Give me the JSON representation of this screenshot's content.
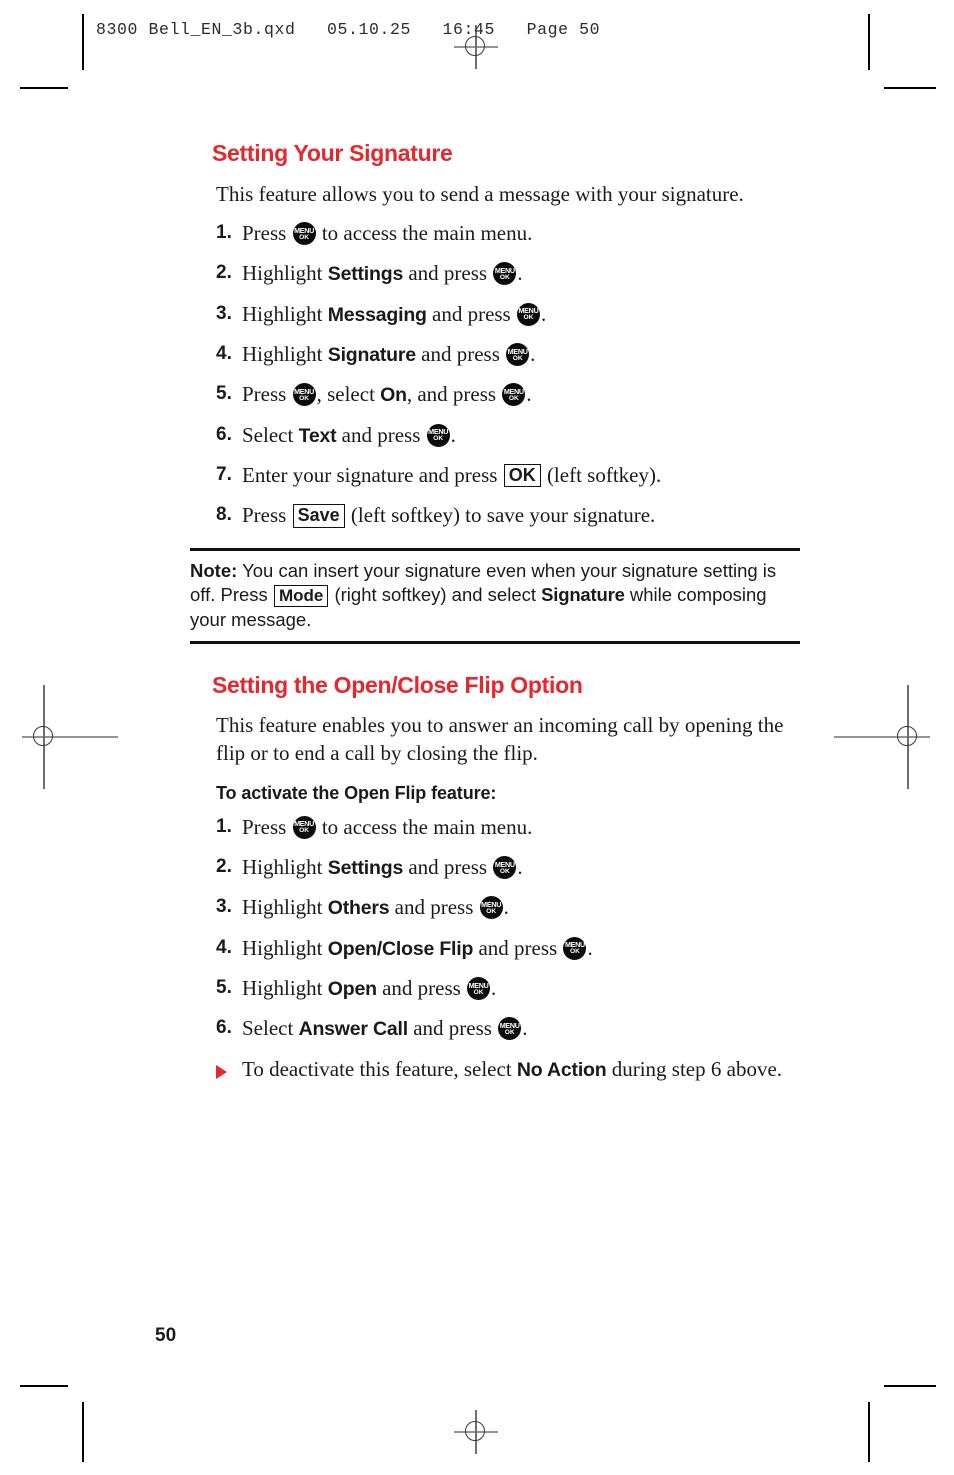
{
  "page": {
    "slug": "8300 Bell_EN_3b.qxd   05.10.25   16:45   Page 50",
    "folio": "50",
    "accent_color": "#E8262C",
    "text_color": "#1a1a1a"
  },
  "icons": {
    "menu_ok": {
      "line1": "MENU",
      "line2": "OK"
    },
    "bullet": "red-triangle-right"
  },
  "sections": [
    {
      "title": "Setting Your Signature",
      "intro": "This feature allows you to send a message with your signature.",
      "steps": [
        {
          "num": "1.",
          "parts": [
            {
              "t": "text",
              "v": "Press "
            },
            {
              "t": "key",
              "v": "MENU/OK"
            },
            {
              "t": "text",
              "v": " to access the main menu."
            }
          ]
        },
        {
          "num": "2.",
          "parts": [
            {
              "t": "text",
              "v": "Highlight "
            },
            {
              "t": "term",
              "v": "Settings"
            },
            {
              "t": "text",
              "v": " and press "
            },
            {
              "t": "key",
              "v": "MENU/OK"
            },
            {
              "t": "text",
              "v": "."
            }
          ]
        },
        {
          "num": "3.",
          "parts": [
            {
              "t": "text",
              "v": "Highlight "
            },
            {
              "t": "term",
              "v": "Messaging"
            },
            {
              "t": "text",
              "v": " and press "
            },
            {
              "t": "key",
              "v": "MENU/OK"
            },
            {
              "t": "text",
              "v": "."
            }
          ]
        },
        {
          "num": "4.",
          "parts": [
            {
              "t": "text",
              "v": "Highlight "
            },
            {
              "t": "term",
              "v": "Signature"
            },
            {
              "t": "text",
              "v": " and press "
            },
            {
              "t": "key",
              "v": "MENU/OK"
            },
            {
              "t": "text",
              "v": "."
            }
          ]
        },
        {
          "num": "5.",
          "parts": [
            {
              "t": "text",
              "v": "Press "
            },
            {
              "t": "key",
              "v": "MENU/OK"
            },
            {
              "t": "text",
              "v": ", select "
            },
            {
              "t": "term",
              "v": "On"
            },
            {
              "t": "text",
              "v": ", and press "
            },
            {
              "t": "key",
              "v": "MENU/OK"
            },
            {
              "t": "text",
              "v": "."
            }
          ]
        },
        {
          "num": "6.",
          "parts": [
            {
              "t": "text",
              "v": "Select "
            },
            {
              "t": "term",
              "v": "Text"
            },
            {
              "t": "text",
              "v": " and press "
            },
            {
              "t": "key",
              "v": "MENU/OK"
            },
            {
              "t": "text",
              "v": "."
            }
          ]
        },
        {
          "num": "7.",
          "parts": [
            {
              "t": "text",
              "v": "Enter your signature and press "
            },
            {
              "t": "softkey",
              "v": "OK"
            },
            {
              "t": "text",
              "v": " (left softkey)."
            }
          ]
        },
        {
          "num": "8.",
          "parts": [
            {
              "t": "text",
              "v": "Press "
            },
            {
              "t": "softkey",
              "v": "Save"
            },
            {
              "t": "text",
              "v": " (left softkey) to save your signature."
            }
          ]
        }
      ],
      "note": {
        "label": "Note:",
        "parts": [
          {
            "t": "bold",
            "v": "Note:"
          },
          {
            "t": "text",
            "v": " You can insert your signature even when your signature setting is off. Press "
          },
          {
            "t": "softkey",
            "v": "Mode"
          },
          {
            "t": "text",
            "v": " (right softkey) and select "
          },
          {
            "t": "term",
            "v": "Signature"
          },
          {
            "t": "text",
            "v": " while composing your message."
          }
        ]
      }
    },
    {
      "title": "Setting the Open/Close Flip Option",
      "intro": "This feature enables you to answer an incoming call by opening the flip or to end a call by closing the flip.",
      "subhead": "To activate the Open Flip feature:",
      "steps": [
        {
          "num": "1.",
          "parts": [
            {
              "t": "text",
              "v": "Press "
            },
            {
              "t": "key",
              "v": "MENU/OK"
            },
            {
              "t": "text",
              "v": " to access the main menu."
            }
          ]
        },
        {
          "num": "2.",
          "parts": [
            {
              "t": "text",
              "v": "Highlight "
            },
            {
              "t": "term",
              "v": "Settings"
            },
            {
              "t": "text",
              "v": " and press "
            },
            {
              "t": "key",
              "v": "MENU/OK"
            },
            {
              "t": "text",
              "v": "."
            }
          ]
        },
        {
          "num": "3.",
          "parts": [
            {
              "t": "text",
              "v": "Highlight "
            },
            {
              "t": "term",
              "v": "Others"
            },
            {
              "t": "text",
              "v": " and press "
            },
            {
              "t": "key",
              "v": "MENU/OK"
            },
            {
              "t": "text",
              "v": "."
            }
          ]
        },
        {
          "num": "4.",
          "parts": [
            {
              "t": "text",
              "v": "Highlight "
            },
            {
              "t": "term",
              "v": "Open/Close Flip"
            },
            {
              "t": "text",
              "v": " and press "
            },
            {
              "t": "key",
              "v": "MENU/OK"
            },
            {
              "t": "text",
              "v": "."
            }
          ]
        },
        {
          "num": "5.",
          "parts": [
            {
              "t": "text",
              "v": "Highlight "
            },
            {
              "t": "term",
              "v": "Open"
            },
            {
              "t": "text",
              "v": " and press "
            },
            {
              "t": "key",
              "v": "MENU/OK"
            },
            {
              "t": "text",
              "v": "."
            }
          ]
        },
        {
          "num": "6.",
          "parts": [
            {
              "t": "text",
              "v": "Select "
            },
            {
              "t": "term",
              "v": "Answer Call"
            },
            {
              "t": "text",
              "v": " and press "
            },
            {
              "t": "key",
              "v": "MENU/OK"
            },
            {
              "t": "text",
              "v": "."
            }
          ]
        }
      ],
      "bullets": [
        {
          "parts": [
            {
              "t": "text",
              "v": "To deactivate this feature, select "
            },
            {
              "t": "term",
              "v": "No Action"
            },
            {
              "t": "text",
              "v": " during step 6 above."
            }
          ]
        }
      ]
    }
  ]
}
